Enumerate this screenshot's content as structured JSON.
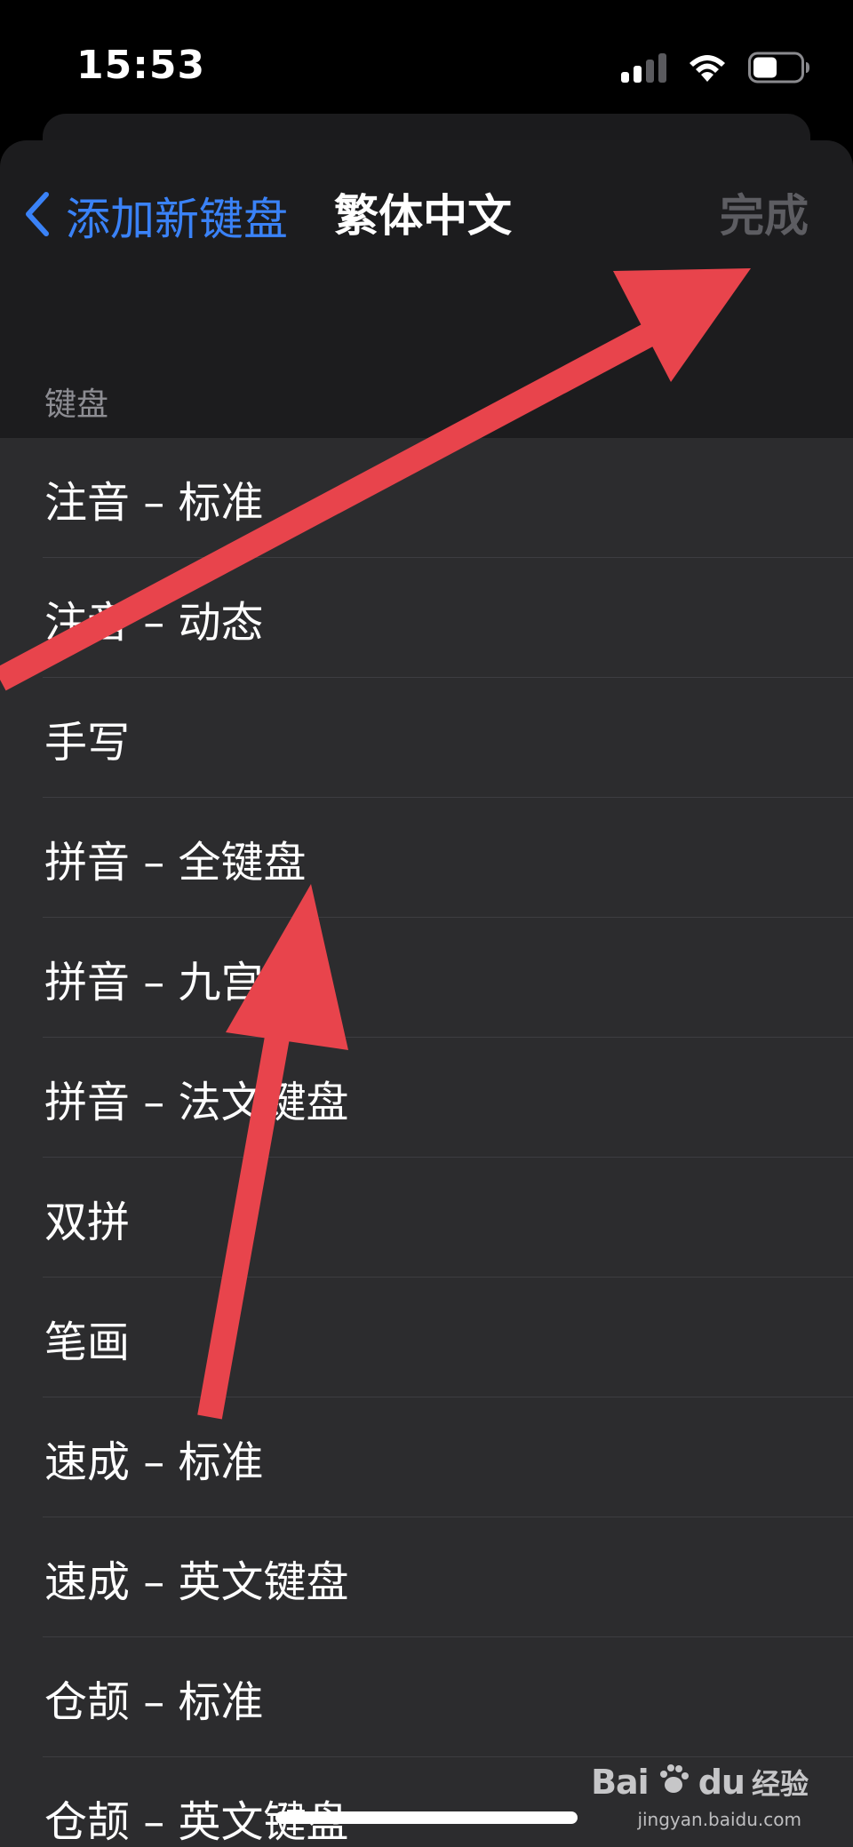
{
  "status_bar": {
    "time": "15:53",
    "signal_icon": "cellular-signal-icon",
    "wifi_icon": "wifi-icon",
    "battery_icon": "battery-icon",
    "battery_level": 0.5
  },
  "nav": {
    "back_label": "添加新键盘",
    "back_icon": "chevron-left-icon",
    "title": "繁体中文",
    "done_label": "完成"
  },
  "section": {
    "header": "键盘",
    "items": [
      {
        "label": "注音 – 标准"
      },
      {
        "label": "注音 – 动态"
      },
      {
        "label": "手写"
      },
      {
        "label": "拼音 – 全键盘"
      },
      {
        "label": "拼音 – 九宫格"
      },
      {
        "label": "拼音 – 法文键盘"
      },
      {
        "label": "双拼"
      },
      {
        "label": "笔画"
      },
      {
        "label": "速成 – 标准"
      },
      {
        "label": "速成 – 英文键盘"
      },
      {
        "label": "仓颉 – 标准"
      },
      {
        "label": "仓颉 – 英文键盘"
      }
    ]
  },
  "watermark": {
    "logo_text": "Bai",
    "logo_text_2": "du",
    "paw_icon": "baidu-paw-icon",
    "label": "经验",
    "url": "jingyan.baidu.com"
  },
  "colors": {
    "accent": "#3a82f7",
    "background": "#1c1c1e",
    "cell": "#2c2c2e",
    "annotation_arrow": "#e8444c",
    "done_disabled": "#5d5d62"
  }
}
